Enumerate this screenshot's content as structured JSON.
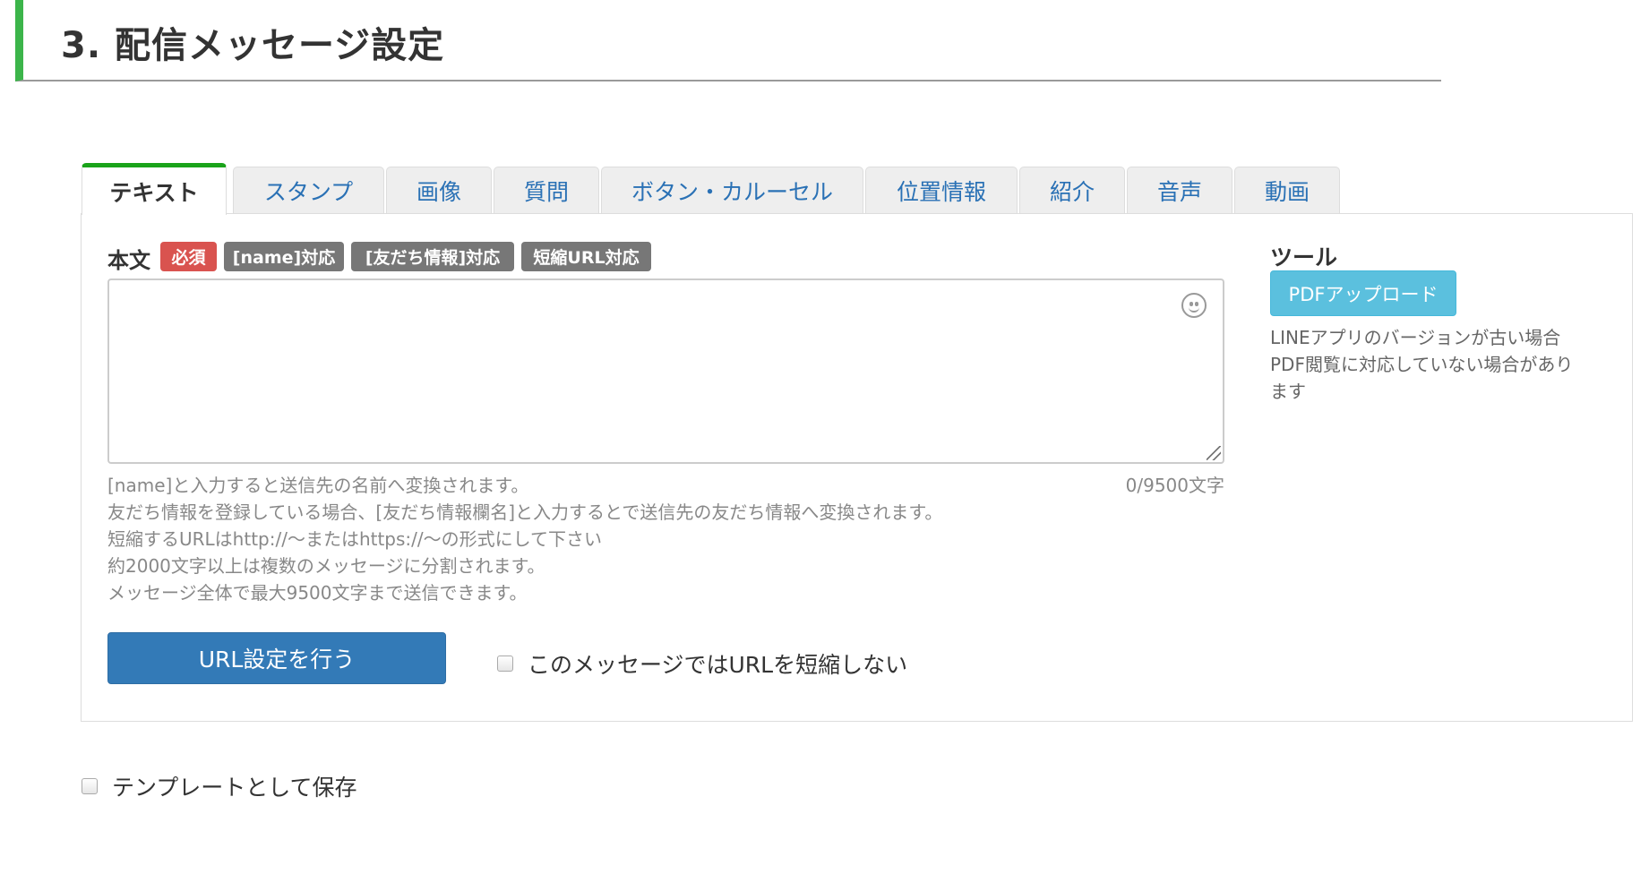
{
  "section": {
    "title": "3. 配信メッセージ設定"
  },
  "tabs": [
    {
      "label": "テキスト",
      "active": true
    },
    {
      "label": "スタンプ"
    },
    {
      "label": "画像"
    },
    {
      "label": "質問"
    },
    {
      "label": "ボタン・カルーセル"
    },
    {
      "label": "位置情報"
    },
    {
      "label": "紹介"
    },
    {
      "label": "音声"
    },
    {
      "label": "動画"
    }
  ],
  "body_field": {
    "label": "本文",
    "badges": [
      "必須",
      "[name]対応",
      "[友だち情報]対応",
      "短縮URL対応"
    ],
    "value": "",
    "counter": "0/9500文字",
    "help_lines": [
      "[name]と入力すると送信先の名前へ変換されます。",
      "友だち情報を登録している場合、[友だち情報欄名]と入力するとで送信先の友だち情報へ変換されます。",
      "短縮するURLはhttp://〜またはhttps://〜の形式にして下さい",
      "約2000文字以上は複数のメッセージに分割されます。",
      "メッセージ全体で最大9500文字まで送信できます。"
    ]
  },
  "actions": {
    "url_button": "URL設定を行う",
    "no_shorten_checkbox": {
      "label": "このメッセージではURLを短縮しない",
      "checked": false
    }
  },
  "tools": {
    "title": "ツール",
    "pdf_button": "PDFアップロード",
    "note_lines": [
      "LINEアプリのバージョンが古い場合",
      "PDF閲覧に対応していない場合があり",
      "ます"
    ]
  },
  "template_checkbox": {
    "label": "テンプレートとして保存",
    "checked": false
  },
  "colors": {
    "accent_green": "#3cb54a",
    "active_tab_border": "#1aa31a",
    "tab_text": "#2a71b5",
    "required_badge": "#d9534f",
    "gray_badge": "#777777",
    "primary_button": "#337ab7",
    "info_button": "#5bc0de"
  },
  "icons": {
    "emoji": "smiley-face-icon"
  }
}
